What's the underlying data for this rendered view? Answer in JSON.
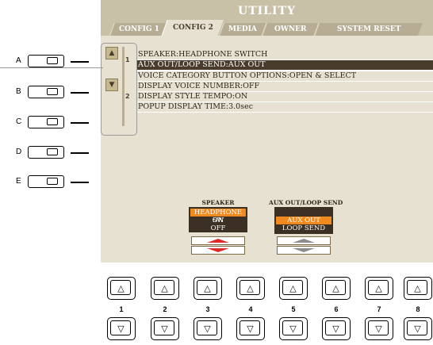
{
  "screen": {
    "title": "UTILITY",
    "tabs": [
      {
        "label": "CONFIG 1",
        "active": false
      },
      {
        "label": "CONFIG 2",
        "active": true
      },
      {
        "label": "MEDIA",
        "active": false
      },
      {
        "label": "OWNER",
        "active": false
      },
      {
        "label": "SYSTEM RESET",
        "active": false
      }
    ],
    "page_numbers": [
      "1",
      "2"
    ],
    "menu_items": [
      "SPEAKER:HEADPHONE SWITCH",
      "AUX OUT/LOOP SEND:AUX OUT",
      "VOICE CATEGORY BUTTON OPTIONS:OPEN & SELECT",
      "DISPLAY VOICE NUMBER:OFF",
      "DISPLAY STYLE TEMPO:ON",
      "POPUP DISPLAY TIME:3.0sec"
    ],
    "selected_item_index": 1,
    "speaker": {
      "title": "SPEAKER",
      "options": [
        "HEADPHONE SW",
        "ON",
        "OFF"
      ],
      "selected": "HEADPHONE SW"
    },
    "aux": {
      "title": "AUX OUT/LOOP SEND",
      "options": [
        "AUX OUT",
        "LOOP SEND"
      ],
      "selected": "AUX OUT"
    }
  },
  "side_buttons": [
    "A",
    "B",
    "C",
    "D",
    "E"
  ],
  "bottom_buttons": [
    "1",
    "2",
    "3",
    "4",
    "5",
    "6",
    "7",
    "8"
  ],
  "icons": {
    "page_up": "up-arrow-icon",
    "page_down": "down-arrow-icon",
    "button_up": "△",
    "button_down": "▽"
  },
  "colors": {
    "screen_frame": "#c9c0a8",
    "screen_body": "#e7e1d1",
    "selection_bar": "#4a3c2c",
    "highlight_orange": "#f08a1e",
    "stepper_red": "#e02a2a"
  }
}
